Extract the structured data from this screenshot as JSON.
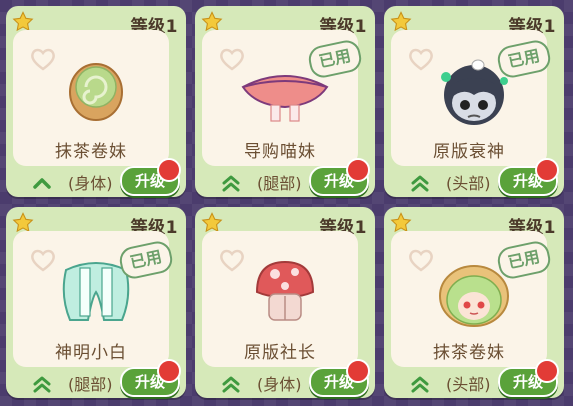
{
  "cards": [
    {
      "level": "等级1",
      "name": "抹茶卷妹",
      "part": "(身体)",
      "upgrade": "升级",
      "used": "",
      "chevron": "single",
      "icon": "matcha-roll-icon"
    },
    {
      "level": "等级1",
      "name": "导购喵妹",
      "part": "(腿部)",
      "upgrade": "升级",
      "used": "已用",
      "chevron": "double",
      "icon": "pink-skirt-icon"
    },
    {
      "level": "等级1",
      "name": "原版衰神",
      "part": "(头部)",
      "upgrade": "升级",
      "used": "已用",
      "chevron": "double",
      "icon": "gloomy-head-icon"
    },
    {
      "level": "等级1",
      "name": "神明小白",
      "part": "(腿部)",
      "upgrade": "升级",
      "used": "已用",
      "chevron": "double",
      "icon": "mint-pants-icon"
    },
    {
      "level": "等级1",
      "name": "原版社长",
      "part": "(身体)",
      "upgrade": "升级",
      "used": "",
      "chevron": "double",
      "icon": "mushroom-body-icon"
    },
    {
      "level": "等级1",
      "name": "抹茶卷妹",
      "part": "(头部)",
      "upgrade": "升级",
      "used": "已用",
      "chevron": "double",
      "icon": "matcha-girl-head-icon"
    }
  ]
}
